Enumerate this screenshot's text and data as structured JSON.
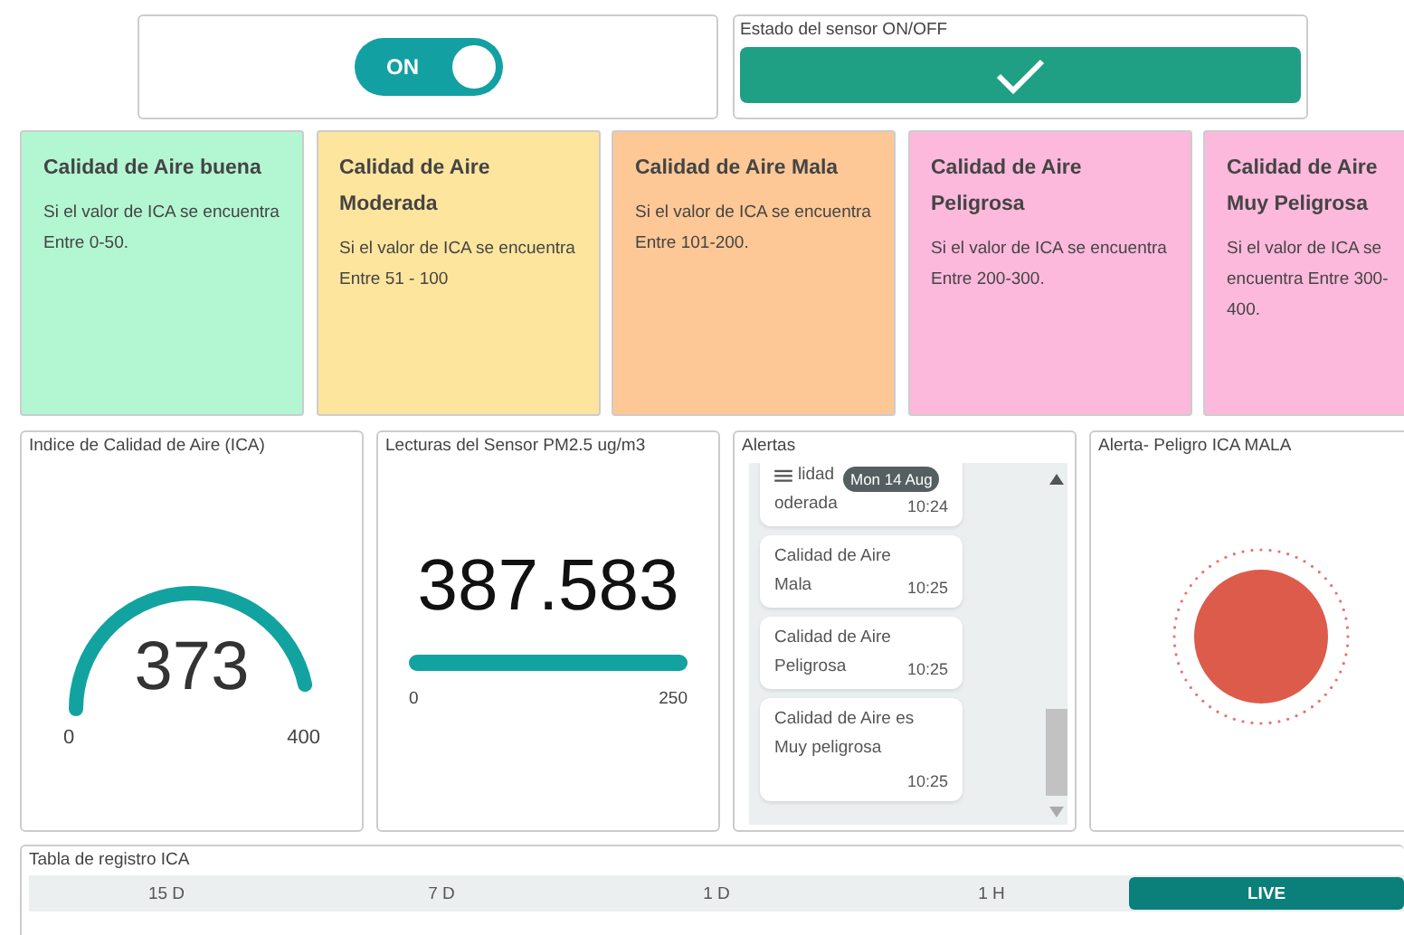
{
  "toggle": {
    "label": "ON",
    "on": true
  },
  "sensor_status": {
    "title": "Estado del sensor ON/OFF",
    "on": true
  },
  "quality_cards": [
    {
      "title": "Calidad de Aire buena",
      "text": "Si el valor de ICA se encuentra Entre 0-50.",
      "color": "#b3f7d2"
    },
    {
      "title": "Calidad de Aire Moderada",
      "text": "Si el valor de ICA se encuentra Entre 51 - 100",
      "color": "#fde59d"
    },
    {
      "title": "Calidad de Aire Mala",
      "text": "Si el valor de ICA se encuentra Entre 101-200.",
      "color": "#fdc896"
    },
    {
      "title": "Calidad de Aire Peligrosa",
      "text": "Si el valor de ICA se encuentra Entre 200-300.",
      "color": "#fcb9dc"
    },
    {
      "title": "Calidad de Aire Muy Peligrosa",
      "text": "Si el valor de ICA se encuentra Entre 300-400.",
      "color": "#fcb9dc"
    }
  ],
  "gauge": {
    "title": "Indice de Calidad de Aire (ICA)",
    "value": "373",
    "min": "0",
    "max": "400"
  },
  "reading": {
    "title": "Lecturas del Sensor PM2.5 ug/m3",
    "value": "387.583",
    "min": "0",
    "max": "250",
    "level": 1
  },
  "alerts": {
    "title": "Alertas",
    "date_badge": "Mon 14 Aug",
    "items": [
      {
        "lines": [
          "lidad",
          "oderada"
        ],
        "time": "10:24"
      },
      {
        "lines": [
          "Calidad de Aire",
          "Mala"
        ],
        "time": "10:25"
      },
      {
        "lines": [
          "Calidad de Aire",
          "Peligrosa"
        ],
        "time": "10:25"
      },
      {
        "lines": [
          "Calidad de Aire es",
          "Muy peligrosa"
        ],
        "time": "10:25"
      }
    ]
  },
  "danger_indicator": {
    "title": "Alerta- Peligro ICA MALA",
    "on": true
  },
  "log_table": {
    "title": "Tabla de registro ICA",
    "ranges": [
      {
        "label": "15 D",
        "selected": false
      },
      {
        "label": "7 D",
        "selected": false
      },
      {
        "label": "1 D",
        "selected": false
      },
      {
        "label": "1 H",
        "selected": false
      },
      {
        "label": "LIVE",
        "selected": true
      }
    ]
  }
}
